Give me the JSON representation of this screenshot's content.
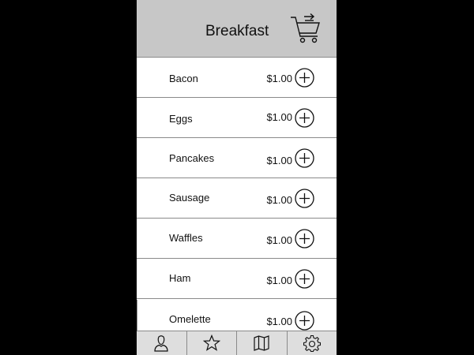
{
  "header": {
    "title": "Breakfast",
    "cart_icon": "shopping-cart-arrow-icon"
  },
  "menu": {
    "items": [
      {
        "name": "Bacon",
        "price": "$1.00"
      },
      {
        "name": "Eggs",
        "price": "$1.00"
      },
      {
        "name": "Pancakes",
        "price": "$1.00"
      },
      {
        "name": "Sausage",
        "price": "$1.00"
      },
      {
        "name": "Waffles",
        "price": "$1.00"
      },
      {
        "name": "Ham",
        "price": "$1.00"
      },
      {
        "name": "Omelette",
        "price": "$1.00"
      }
    ],
    "add_icon": "plus-circle-icon"
  },
  "tabbar": {
    "tabs": [
      {
        "icon": "user-icon"
      },
      {
        "icon": "star-icon"
      },
      {
        "icon": "map-icon"
      },
      {
        "icon": "gear-icon"
      }
    ]
  },
  "colors": {
    "header_bg": "#c7c7c7",
    "tabbar_bg": "#dedede",
    "divider": "#8a8a8a",
    "background": "#000000"
  }
}
